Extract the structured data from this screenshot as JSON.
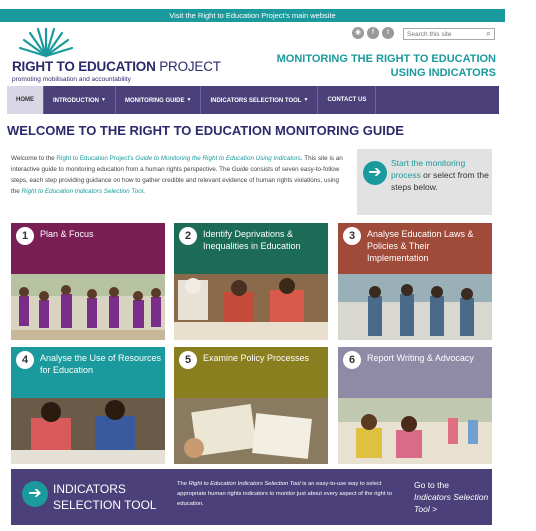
{
  "topbar": {
    "text": "Visit the Right to Education Project's main website"
  },
  "logo": {
    "title_main": "RIGHT TO EDUCATION",
    "title_proj": "PROJECT",
    "tagline": "promoting mobilisation and accountability"
  },
  "social": {
    "rss": "rss-icon",
    "facebook": "facebook-icon",
    "twitter": "twitter-icon"
  },
  "search": {
    "placeholder": "Search this site"
  },
  "site_subtitle": {
    "line1": "MONITORING THE RIGHT TO EDUCATION",
    "line2": "USING INDICATORS"
  },
  "nav": {
    "home": "HOME",
    "introduction": "INTRODUCTION",
    "monitoring_guide": "MONITORING GUIDE",
    "indicators_tool": "INDICATORS SELECTION TOOL",
    "contact": "CONTACT US"
  },
  "page_title": "WELCOME TO THE RIGHT TO EDUCATION MONITORING GUIDE",
  "intro": {
    "p1": "Welcome to the",
    "p1_link": "Right to Education Project's",
    "p1_guide": "Guide to Monitoring the Right to Education Using Indicators",
    "p2": ". This site is an interactive guide to monitoring education from a human rights perspective. The",
    "p2_guide": "Guide",
    "p3": "consists of seven easy-to-follow steps, each step providing guidance on how to gather credible and relevant evidence of human rights violations, using the",
    "p3_link": "Right to Education Indicators Selection Tool",
    "p3_end": "."
  },
  "start_box": {
    "line1": "Start the monitoring",
    "line2": "process",
    "line3": "or select from the steps below."
  },
  "steps": [
    {
      "num": "1",
      "label": "Plan & Focus",
      "color": "#7a1f55"
    },
    {
      "num": "2",
      "label": "Identify Deprivations & Inequalities in Education",
      "color": "#1c6b57"
    },
    {
      "num": "3",
      "label": "Analyse Education Laws & Policies & Their Implementation",
      "color": "#a04a3a"
    },
    {
      "num": "4",
      "label": "Analyse the Use of Resources for Education",
      "color": "#1a9a9c"
    },
    {
      "num": "5",
      "label": "Examine Policy Processes",
      "color": "#8a7f1f"
    },
    {
      "num": "6",
      "label": "Report Writing & Advocacy",
      "color": "#8f8aa6"
    }
  ],
  "ist": {
    "title1": "INDICATORS",
    "title2": "SELECTION TOOL",
    "desc_pre": "The",
    "desc_italic": "Right to Education Indicators Selection Tool",
    "desc_post": "is an easy-to-use way to select appropriate human rights indicators to monitor just about every aspect of the right to education.",
    "go1": "Go to the",
    "go2": "Indicators Selection Tool >"
  },
  "colors": {
    "teal": "#1a9a9c",
    "purple": "#4b4079",
    "navy": "#2c2a6b"
  }
}
